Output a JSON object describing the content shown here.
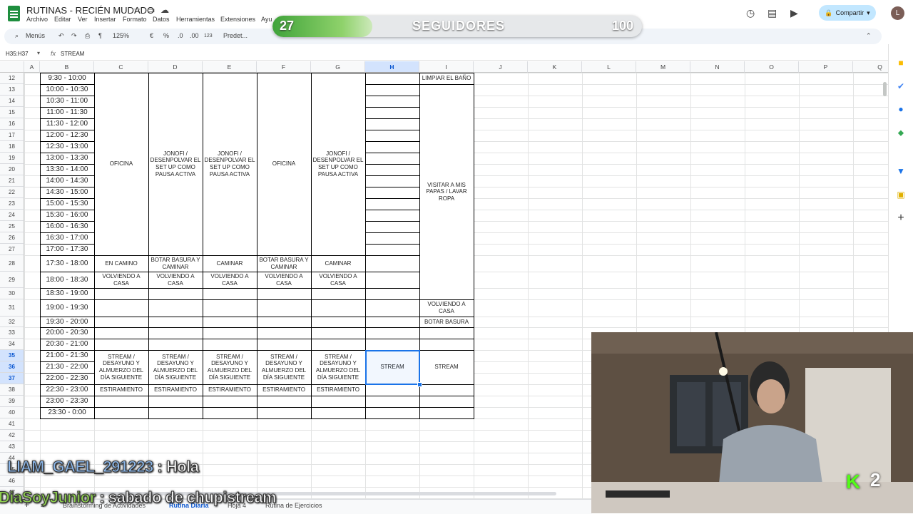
{
  "doc": {
    "title": "RUTINAS - RECIÉN MUDADO"
  },
  "menu": [
    "Archivo",
    "Editar",
    "Ver",
    "Insertar",
    "Formato",
    "Datos",
    "Herramientas",
    "Extensiones",
    "Ayu"
  ],
  "header": {
    "share_label": "Compartir",
    "avatar_initial": "L"
  },
  "toolbar": {
    "menus_label": "Menús",
    "zoom": "125%",
    "currency": "€",
    "percent": "%",
    "dec_less": ".0",
    "dec_more": ".00",
    "number_format": "123",
    "font": "Predet..."
  },
  "formula": {
    "namebox": "H35:H37",
    "fx": "fx",
    "value": "STREAM"
  },
  "columns": [
    "A",
    "B",
    "C",
    "D",
    "E",
    "F",
    "G",
    "H",
    "I",
    "J",
    "K",
    "L",
    "M",
    "N",
    "O",
    "P",
    "Q"
  ],
  "selected_column": "H",
  "rows": [
    "12",
    "13",
    "14",
    "15",
    "16",
    "17",
    "18",
    "19",
    "20",
    "21",
    "22",
    "23",
    "24",
    "25",
    "26",
    "27",
    "28",
    "29",
    "30",
    "31",
    "32",
    "33",
    "34",
    "35",
    "36",
    "37",
    "38",
    "39",
    "40",
    "41",
    "42",
    "43",
    "44",
    "45",
    "46",
    "47"
  ],
  "selected_rows": [
    "35",
    "36",
    "37"
  ],
  "times": [
    "9:30 - 10:00",
    "10:00 - 10:30",
    "10:30 - 11:00",
    "11:00 - 11:30",
    "11:30 - 12:00",
    "12:00 - 12:30",
    "12:30 - 13:00",
    "13:00 - 13:30",
    "13:30 - 14:00",
    "14:00 - 14:30",
    "14:30 - 15:00",
    "15:00 - 15:30",
    "15:30 - 16:00",
    "16:00 - 16:30",
    "16:30 - 17:00",
    "17:00 - 17:30",
    "17:30 - 18:00",
    "18:00 - 18:30",
    "18:30 - 19:00",
    "19:00 - 19:30",
    "19:30 - 20:00",
    "20:00 - 20:30",
    "20:30 - 21:00",
    "21:00 - 21:30",
    "21:30 - 22:00",
    "22:00 - 22:30",
    "22:30 - 23:00",
    "23:00 - 23:30",
    "23:30 - 0:00"
  ],
  "cells": {
    "oficina": "OFICINA",
    "jonofi": "JONOFI / DESENPOLVAR EL SET UP COMO PAUSA ACTIVA",
    "en_camino": "EN CAMINO",
    "botar_caminar": "BOTAR BASURA Y CAMINAR",
    "caminar": "CAMINAR",
    "volviendo": "VOLVIENDO A CASA",
    "stream_block": "STREAM / DESAYUNO Y ALMUERZO DEL DÍA SIGUIENTE",
    "stream": "STREAM",
    "estiramiento": "ESTIRAMIENTO",
    "limpiar": "LIMPIAR EL BAÑO",
    "visitar": "VISITAR A MIS PAPAS / LAVAR ROPA",
    "botar_basura": "BOTAR BASURA"
  },
  "tabs": [
    "Brainstorming de Actividades",
    "Rutina Diaria",
    "Hoja 4",
    "Rutina de Ejercicios"
  ],
  "active_tab": "Rutina Diaria",
  "overlay": {
    "followers_current": "27",
    "followers_label": "SEGUIDORES",
    "followers_goal": "100",
    "followers_progress": 0.27,
    "chat": [
      {
        "user": "LIAM_GAEL_291223",
        "sep": " : ",
        "message": "Hola"
      },
      {
        "user": "DiaSoyJunior",
        "sep": " : ",
        "message": "sabado de chupistream"
      }
    ],
    "viewer_count": "2",
    "platform_icon": "kick-icon"
  }
}
